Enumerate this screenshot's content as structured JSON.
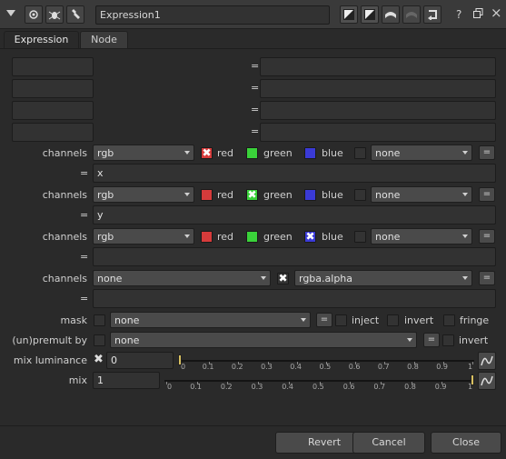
{
  "header": {
    "node_name": "Expression1",
    "help_icon": "?",
    "float_icon": "float-icon",
    "close_icon": "×"
  },
  "tabs": [
    {
      "label": "Expression"
    },
    {
      "label": "Node"
    }
  ],
  "expressions": {
    "temp_rows": [
      {
        "name": "",
        "value": "",
        "eq": "="
      },
      {
        "name": "",
        "value": "",
        "eq": "="
      },
      {
        "name": "",
        "value": "",
        "eq": "="
      },
      {
        "name": "",
        "value": "",
        "eq": "="
      }
    ],
    "channel_rows": [
      {
        "label": "channels",
        "layer": "rgb",
        "red": "red",
        "green": "green",
        "blue": "blue",
        "extra": "none",
        "eq": "=",
        "expr": "x",
        "checked": "red"
      },
      {
        "label": "channels",
        "layer": "rgb",
        "red": "red",
        "green": "green",
        "blue": "blue",
        "extra": "none",
        "eq": "=",
        "expr": "y",
        "checked": "green"
      },
      {
        "label": "channels",
        "layer": "rgb",
        "red": "red",
        "green": "green",
        "blue": "blue",
        "extra": "none",
        "eq": "=",
        "expr": "",
        "checked": "blue"
      }
    ],
    "alpha_row": {
      "label": "channels",
      "layer": "none",
      "channel": "rgba.alpha",
      "eq": "=",
      "expr": ""
    }
  },
  "mask": {
    "label": "mask",
    "value": "none",
    "inject": "inject",
    "invert": "invert",
    "fringe": "fringe"
  },
  "premult": {
    "label": "(un)premult by",
    "value": "none",
    "invert": "invert"
  },
  "mix_luminance": {
    "label": "mix luminance",
    "value": "0",
    "ticks": [
      "0",
      "0.1",
      "0.2",
      "0.3",
      "0.4",
      "0.5",
      "0.6",
      "0.7",
      "0.8",
      "0.9",
      "1"
    ],
    "level": 0
  },
  "mix": {
    "label": "mix",
    "value": "1",
    "ticks": [
      "0",
      "0.1",
      "0.2",
      "0.3",
      "0.4",
      "0.5",
      "0.6",
      "0.7",
      "0.8",
      "0.9",
      "1"
    ],
    "level": 1
  },
  "footer": {
    "revert": "Revert",
    "cancel": "Cancel",
    "close": "Close"
  },
  "colors": {
    "red": "#d63b3b",
    "green": "#3ad23a",
    "blue": "#3a3ad6",
    "handle": "#d8c060"
  }
}
